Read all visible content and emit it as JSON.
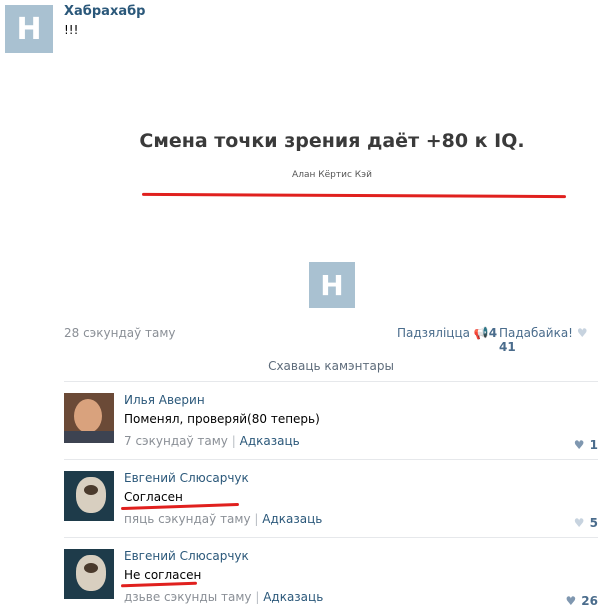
{
  "post": {
    "author": "Хабрахабр",
    "text": "!!!",
    "quote": "Смена точки зрения даёт +80 к IQ.",
    "quote_author": "Алан Кёртис Кэй",
    "logo_letter": "H",
    "time": "28 сэкундаў таму",
    "share_label": "Падзяліцца",
    "share_count": "4",
    "like_label": "Падабайка!",
    "like_count": "41",
    "hide_comments": "Схаваць камэнтары"
  },
  "comments": [
    {
      "author": "Илья Аверин",
      "text": "Поменял, проверяй(80 теперь)",
      "time": "7 сэкундаў таму",
      "reply": "Адказаць",
      "likes": "1"
    },
    {
      "author": "Евгений Слюсарчук",
      "text": "Согласен",
      "time": "пяць сэкундаў таму",
      "reply": "Адказаць",
      "likes": "5"
    },
    {
      "author": "Евгений Слюсарчук",
      "text": "Не согласен",
      "time": "дзьве сэкунды таму",
      "reply": "Адказаць",
      "likes": "26"
    }
  ],
  "colors": {
    "link": "#2b587a",
    "annotation_red": "#e0201e",
    "logo_bg": "#a9c1d1"
  }
}
